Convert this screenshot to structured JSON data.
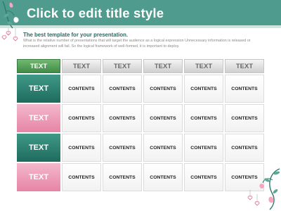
{
  "slide": {
    "title": "Click to edit title style",
    "subtitle": "The best template for your presentation.",
    "description": "What is the relative number of presentations that will target the audience as a logical expression Unnecessary information is released or increased alignment will fail. So the logical framework of well-formed, it is important to deploy."
  },
  "table": {
    "header": [
      "TEXT",
      "TEXT",
      "TEXT",
      "TEXT",
      "TEXT",
      "TEXT"
    ],
    "rows": [
      {
        "label": "TEXT",
        "cells": [
          "CONTENTS",
          "CONTENTS",
          "CONTENTS",
          "CONTENTS",
          "CONTENTS"
        ]
      },
      {
        "label": "TEXT",
        "cells": [
          "CONTENTS",
          "CONTENTS",
          "CONTENTS",
          "CONTENTS",
          "CONTENTS"
        ]
      },
      {
        "label": "TEXT",
        "cells": [
          "CONTENTS",
          "CONTENTS",
          "CONTENTS",
          "CONTENTS",
          "CONTENTS"
        ]
      },
      {
        "label": "TEXT",
        "cells": [
          "CONTENTS",
          "CONTENTS",
          "CONTENTS",
          "CONTENTS",
          "CONTENTS"
        ]
      }
    ]
  },
  "colors": {
    "title_band": "#4f9c8f",
    "row_green": "#2a7d70",
    "row_pink": "#ef9fbb",
    "header_accent": "#4f9a52"
  },
  "decorations": [
    "floral-vine-top-left",
    "floral-vine-bottom-right",
    "hanging-heart-icons"
  ]
}
